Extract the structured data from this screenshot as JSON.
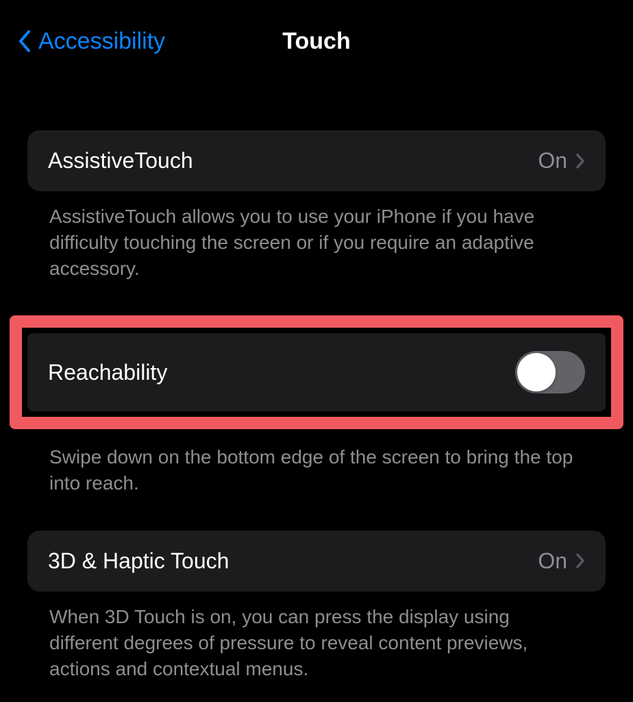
{
  "header": {
    "back_label": "Accessibility",
    "title": "Touch"
  },
  "sections": {
    "assistive_touch": {
      "label": "AssistiveTouch",
      "value": "On",
      "footer": "AssistiveTouch allows you to use your iPhone if you have difficulty touching the screen or if you require an adaptive accessory."
    },
    "reachability": {
      "label": "Reachability",
      "toggle_on": false,
      "footer": "Swipe down on the bottom edge of the screen to bring the top into reach."
    },
    "haptic_touch": {
      "label": "3D & Haptic Touch",
      "value": "On",
      "footer": "When 3D Touch is on, you can press the display using different degrees of pressure to reveal content previews, actions and contextual menus."
    }
  }
}
